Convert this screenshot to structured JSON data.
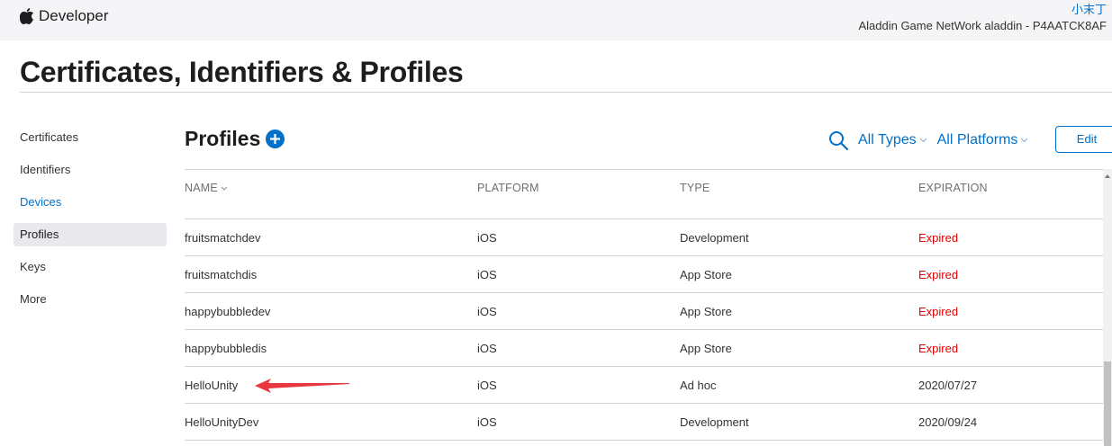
{
  "header": {
    "brand": "Developer",
    "user_name": "小末丁",
    "team": "Aladdin Game NetWork aladdin - P4AATCK8AF"
  },
  "page_title": "Certificates, Identifiers & Profiles",
  "sidebar": {
    "items": [
      {
        "label": "Certificates"
      },
      {
        "label": "Identifiers"
      },
      {
        "label": "Devices"
      },
      {
        "label": "Profiles"
      },
      {
        "label": "Keys"
      },
      {
        "label": "More"
      }
    ]
  },
  "section": {
    "title": "Profiles",
    "filter_types": "All Types",
    "filter_platforms": "All Platforms",
    "edit_label": "Edit"
  },
  "table": {
    "headers": {
      "name": "NAME",
      "platform": "PLATFORM",
      "type": "TYPE",
      "expiration": "EXPIRATION"
    },
    "rows": [
      {
        "name": "fruitsmatchdev",
        "platform": "iOS",
        "type": "Development",
        "expiration": "Expired"
      },
      {
        "name": "fruitsmatchdis",
        "platform": "iOS",
        "type": "App Store",
        "expiration": "Expired"
      },
      {
        "name": "happybubbledev",
        "platform": "iOS",
        "type": "App Store",
        "expiration": "Expired"
      },
      {
        "name": "happybubbledis",
        "platform": "iOS",
        "type": "App Store",
        "expiration": "Expired"
      },
      {
        "name": "HelloUnity",
        "platform": "iOS",
        "type": "Ad hoc",
        "expiration": "2020/07/27"
      },
      {
        "name": "HelloUnityDev",
        "platform": "iOS",
        "type": "Development",
        "expiration": "2020/09/24"
      }
    ]
  },
  "icons": {
    "brand": "apple-logo-icon",
    "add": "plus-circle-icon",
    "search": "search-icon",
    "sort": "chevron-down-icon",
    "annotation": "red-arrow-icon"
  },
  "colors": {
    "accent": "#0070c9",
    "expired": "#e30000",
    "annotation_arrow": "#e8383d"
  }
}
